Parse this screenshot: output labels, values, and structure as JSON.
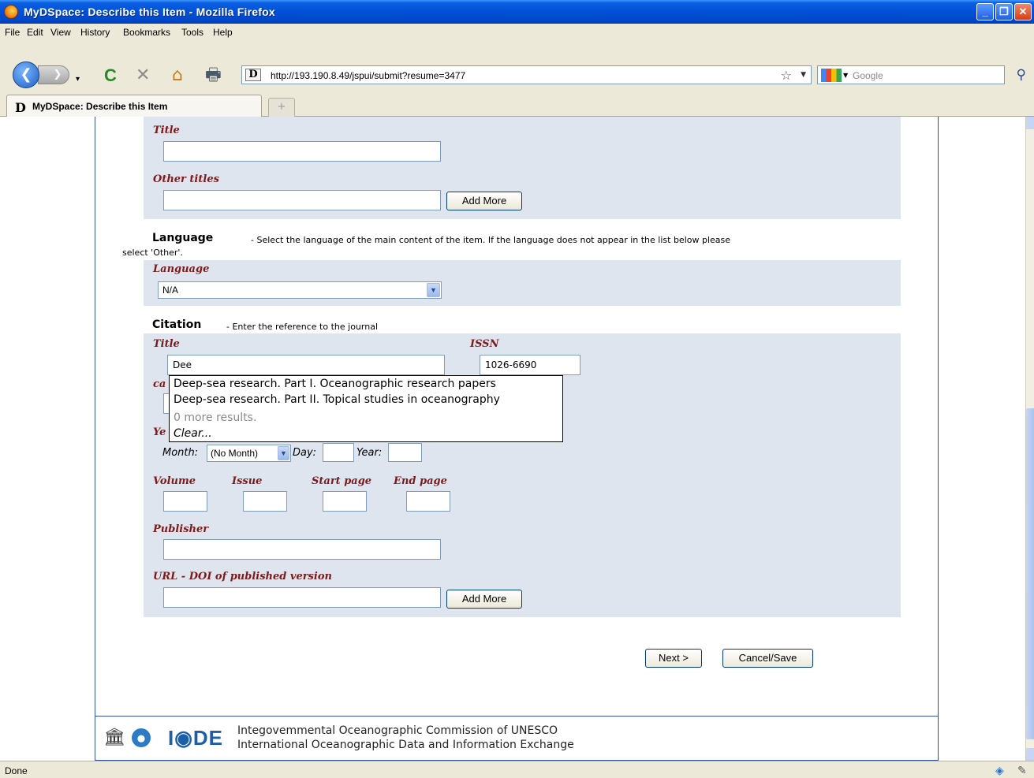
{
  "window": {
    "title": "MyDSpace: Describe this Item - Mozilla Firefox",
    "minimize_glyph": "_",
    "maximize_glyph": "❐",
    "close_glyph": "✕"
  },
  "menu": [
    "File",
    "Edit",
    "View",
    "History",
    "Bookmarks",
    "Tools",
    "Help"
  ],
  "toolbar": {
    "back_glyph": "❮",
    "forward_glyph": "❯",
    "reload_glyph": "C",
    "stop_glyph": "✕",
    "home_glyph": "⌂",
    "print_glyph": "🖶",
    "url": "http://193.190.8.49/jspui/submit?resume=3477",
    "url_favicon": "D",
    "bookmark_star": "☆",
    "search_placeholder": "Google",
    "search_icon": "⚲"
  },
  "tabs": [
    {
      "label": "MyDSpace: Describe this Item",
      "favicon": "D",
      "active": true
    }
  ],
  "new_tab_glyph": "+",
  "form": {
    "title_label": "Title",
    "title_value": "",
    "other_titles_label": "Other titles",
    "other_titles_value": "",
    "add_more_label": "Add More",
    "language_section": {
      "heading": "Language",
      "description_line1": "- Select the language of the main content of the item. If the language does not appear in the list below please",
      "description_line2": "select 'Other'.",
      "field_label": "Language",
      "selected": "N/A"
    },
    "citation_section": {
      "heading": "Citation",
      "description": "- Enter the reference to the journal",
      "title_label": "Title",
      "title_value": "Dee",
      "issn_label": "ISSN",
      "issn_value": "1026-6690",
      "hidden_label_prefix_1": "ca",
      "hidden_label_prefix_2": "Ye",
      "month_label": "Month:",
      "month_value": "(No Month)",
      "day_label": "Day:",
      "year_label": "Year:",
      "volume_label": "Volume",
      "issue_label": "Issue",
      "start_page_label": "Start page",
      "end_page_label": "End page",
      "publisher_label": "Publisher",
      "url_doi_label": "URL - DOI of published version",
      "add_more_label": "Add More"
    },
    "autocomplete": {
      "suggestions": [
        "Deep-sea research. Part I. Oceanographic research papers",
        "Deep-sea research. Part II. Topical studies in oceanography"
      ],
      "more_results": "0 more results.",
      "clear": "Clear..."
    },
    "next_label": "Next >",
    "cancel_save_label": "Cancel/Save"
  },
  "footer": {
    "logo_text": "I◉DE",
    "line1": "Integovemmental Oceanographic Commission of UNESCO",
    "line2": "International Oceanographic Data and Information Exchange"
  },
  "status": {
    "text": "Done"
  }
}
